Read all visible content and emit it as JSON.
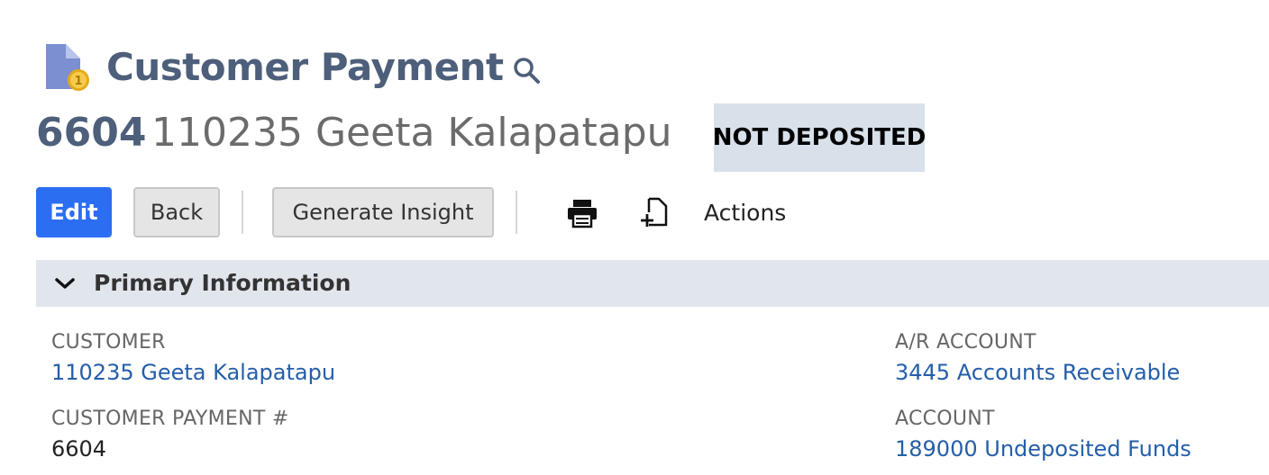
{
  "header": {
    "title": "Customer Payment",
    "record_number": "6604",
    "record_name": "110235 Geeta Kalapatapu",
    "status": "NOT DEPOSITED"
  },
  "toolbar": {
    "edit_label": "Edit",
    "back_label": "Back",
    "insight_label": "Generate Insight",
    "actions_label": "Actions"
  },
  "section": {
    "title": "Primary Information"
  },
  "fields": {
    "customer": {
      "label": "CUSTOMER",
      "value": "110235 Geeta Kalapatapu"
    },
    "payment_number": {
      "label": "CUSTOMER PAYMENT #",
      "value": "6604"
    },
    "ar_account": {
      "label": "A/R ACCOUNT",
      "value": "3445 Accounts Receivable"
    },
    "account": {
      "label": "ACCOUNT",
      "value": "189000 Undeposited Funds"
    }
  },
  "colors": {
    "title": "#4d5f7a",
    "primary_button": "#2c6ef2",
    "status_badge_bg": "#d8e0ea",
    "section_bar_bg": "#e1e5ec",
    "link": "#255ea8"
  },
  "icons": {
    "page": "customer-payment-document-coin-icon",
    "search": "search-icon",
    "print": "print-icon",
    "new_document": "new-document-icon",
    "section_toggle": "chevron-down-icon"
  }
}
